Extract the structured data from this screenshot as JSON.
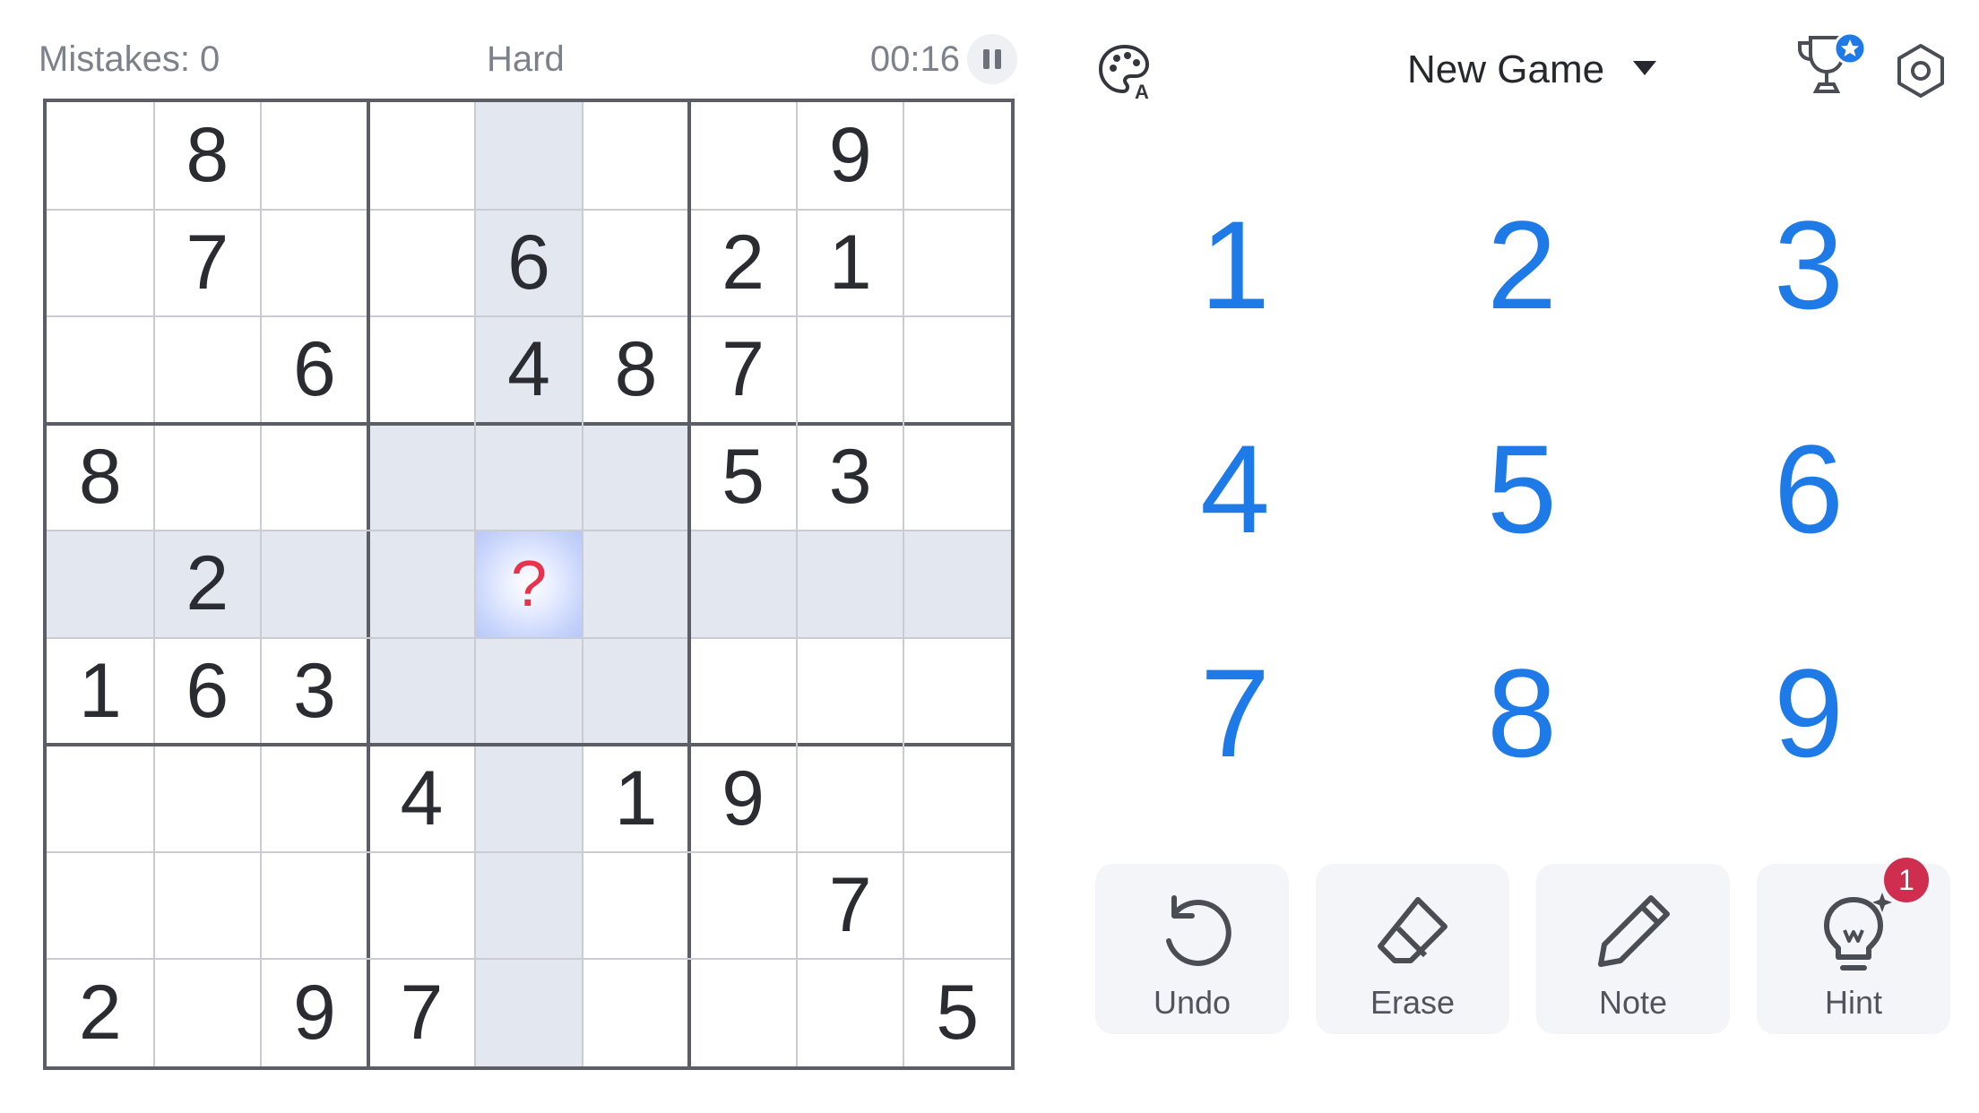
{
  "status": {
    "mistakes": "Mistakes: 0",
    "difficulty": "Hard",
    "timer": "00:16"
  },
  "header": {
    "new_game_label": "New Game"
  },
  "board": {
    "rows": [
      [
        "",
        "8",
        "",
        "",
        "",
        "",
        "",
        "9",
        ""
      ],
      [
        "",
        "7",
        "",
        "",
        "6",
        "",
        "2",
        "1",
        ""
      ],
      [
        "",
        "",
        "6",
        "",
        "4",
        "8",
        "7",
        "",
        ""
      ],
      [
        "8",
        "",
        "",
        "",
        "",
        "",
        "5",
        "3",
        ""
      ],
      [
        "",
        "2",
        "",
        "",
        "?",
        "",
        "",
        "",
        ""
      ],
      [
        "1",
        "6",
        "3",
        "",
        "",
        "",
        "",
        "",
        ""
      ],
      [
        "",
        "",
        "",
        "4",
        "",
        "1",
        "9",
        "",
        ""
      ],
      [
        "",
        "",
        "",
        "",
        "",
        "",
        "",
        "7",
        ""
      ],
      [
        "2",
        "",
        "9",
        "7",
        "",
        "",
        "",
        "",
        "5"
      ]
    ],
    "selected": {
      "row": 4,
      "col": 4
    }
  },
  "numpad": [
    "1",
    "2",
    "3",
    "4",
    "5",
    "6",
    "7",
    "8",
    "9"
  ],
  "actions": {
    "undo": "Undo",
    "erase": "Erase",
    "note": "Note",
    "hint": "Hint",
    "hint_count": "1"
  },
  "colors": {
    "accent": "#1e7ae6",
    "highlight": "#e3e7f0",
    "selected": "#c6d3fb",
    "badge": "#cf2e4e",
    "error": "#e8334b"
  },
  "icons": [
    "palette-icon",
    "caret-down-icon",
    "trophy-icon",
    "star-badge-icon",
    "settings-icon",
    "pause-icon",
    "undo-icon",
    "eraser-icon",
    "pencil-icon",
    "lightbulb-icon"
  ]
}
